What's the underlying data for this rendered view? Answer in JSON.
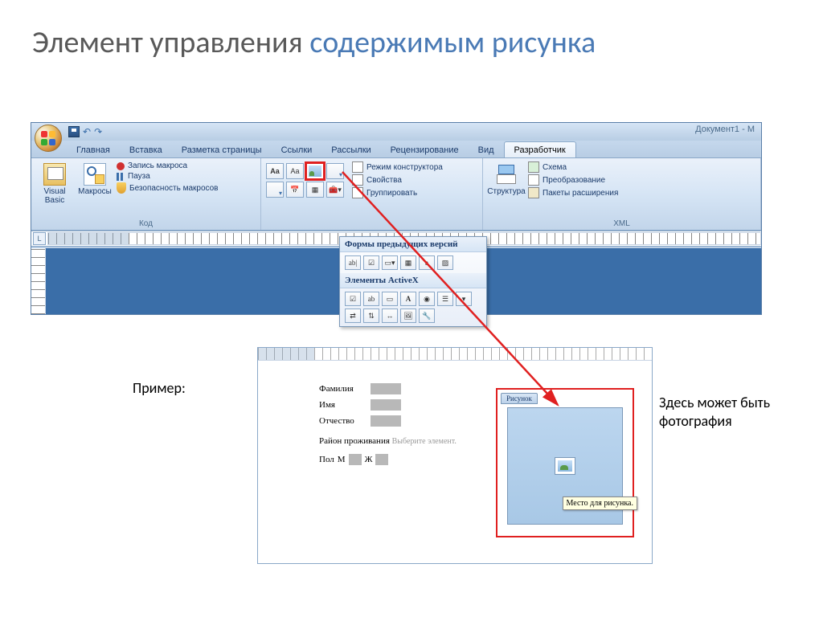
{
  "slide": {
    "title_part1": "Элемент управления ",
    "title_part2": "содержимым рисунка"
  },
  "word": {
    "doc_title": "Документ1 - M",
    "tabs": {
      "home": "Главная",
      "insert": "Вставка",
      "layout": "Разметка страницы",
      "refs": "Ссылки",
      "mail": "Рассылки",
      "review": "Рецензирование",
      "view": "Вид",
      "dev": "Разработчик"
    },
    "groups": {
      "code": "Код",
      "xml": "XML"
    },
    "code": {
      "vb": "Visual Basic",
      "macros": "Макросы",
      "record": "Запись макроса",
      "pause": "Пауза",
      "security": "Безопасность макросов"
    },
    "controls": {
      "aa": "Aa",
      "aa2": "Aa",
      "design": "Режим конструктора",
      "props": "Свойства",
      "group": "Группировать"
    },
    "xml": {
      "structure": "Структура",
      "schema": "Схема",
      "transform": "Преобразование",
      "packages": "Пакеты расширения"
    },
    "dropdown": {
      "legacy_title": "Формы предыдущих версий",
      "activex_title": "Элементы ActiveX",
      "ab": "ab|",
      "a": "a"
    },
    "ruler_L": "L"
  },
  "example": {
    "label": "Пример:",
    "note": "Здесь может быть фотография",
    "surname": "Фамилия",
    "name": "Имя",
    "patronymic": "Отчество",
    "region": "Район проживания",
    "region_hint": "Выберите элемент.",
    "gender": "Пол",
    "m": "М",
    "f": "Ж",
    "pic_tab": "Рисунок",
    "pic_tooltip": "Место для рисунка."
  }
}
